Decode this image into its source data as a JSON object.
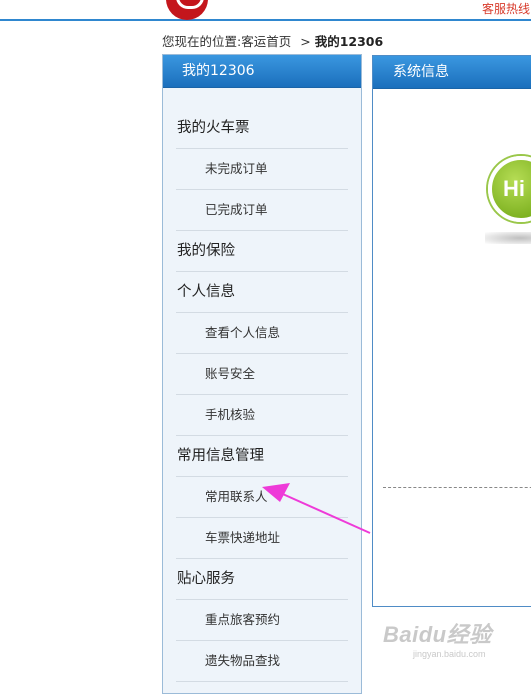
{
  "header": {
    "hotline_text": "客服热线"
  },
  "breadcrumb": {
    "prefix": "您现在的位置:",
    "home": "客运首页",
    "separator": ">",
    "current": "我的12306"
  },
  "sidebar": {
    "title": "我的12306",
    "items": [
      {
        "label": "我的火车票",
        "type": "group"
      },
      {
        "label": "未完成订单",
        "type": "sub"
      },
      {
        "label": "已完成订单",
        "type": "sub"
      },
      {
        "label": "我的保险",
        "type": "group"
      },
      {
        "label": "个人信息",
        "type": "group"
      },
      {
        "label": "查看个人信息",
        "type": "sub"
      },
      {
        "label": "账号安全",
        "type": "sub"
      },
      {
        "label": "手机核验",
        "type": "sub"
      },
      {
        "label": "常用信息管理",
        "type": "group"
      },
      {
        "label": "常用联系人",
        "type": "sub"
      },
      {
        "label": "车票快递地址",
        "type": "sub"
      },
      {
        "label": "贴心服务",
        "type": "group"
      },
      {
        "label": "重点旅客预约",
        "type": "sub"
      },
      {
        "label": "遗失物品查找",
        "type": "sub"
      }
    ]
  },
  "system_info": {
    "title": "系统信息",
    "badge_text": "Hi"
  },
  "watermark": {
    "brand": "Baidu经验",
    "url": "jingyan.baidu.com"
  },
  "colors": {
    "header_blue": "#1b6fbc",
    "hotline_red": "#d83a2b",
    "arrow_magenta": "#ee3ad8",
    "sidebar_bg": "#eef4fa"
  }
}
